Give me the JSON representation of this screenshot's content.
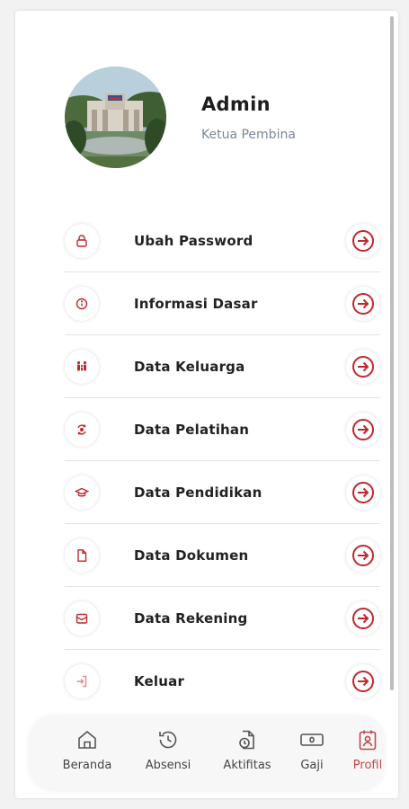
{
  "profile": {
    "name": "Admin",
    "role": "Ketua Pembina"
  },
  "menu": {
    "items": [
      {
        "label": "Ubah Password",
        "icon": "lock-icon"
      },
      {
        "label": "Informasi Dasar",
        "icon": "info-icon"
      },
      {
        "label": "Data Keluarga",
        "icon": "family-icon"
      },
      {
        "label": "Data Pelatihan",
        "icon": "training-icon"
      },
      {
        "label": "Data Pendidikan",
        "icon": "graduation-cap-icon"
      },
      {
        "label": "Data Dokumen",
        "icon": "document-icon"
      },
      {
        "label": "Data Rekening",
        "icon": "wallet-icon"
      },
      {
        "label": "Keluar",
        "icon": "logout-icon"
      }
    ],
    "arrow_icon": "arrow-right-circle-icon"
  },
  "nav": {
    "items": [
      {
        "label": "Beranda",
        "icon": "home-icon",
        "active": false
      },
      {
        "label": "Absensi",
        "icon": "history-icon",
        "active": false
      },
      {
        "label": "Aktifitas",
        "icon": "activity-icon",
        "active": false
      },
      {
        "label": "Gaji",
        "icon": "money-icon",
        "active": false
      },
      {
        "label": "Profil",
        "icon": "profile-icon",
        "active": true
      }
    ]
  },
  "colors": {
    "accent": "#c0272d",
    "accent_soft": "#c0474b",
    "text": "#222222",
    "muted": "#7a879a"
  }
}
